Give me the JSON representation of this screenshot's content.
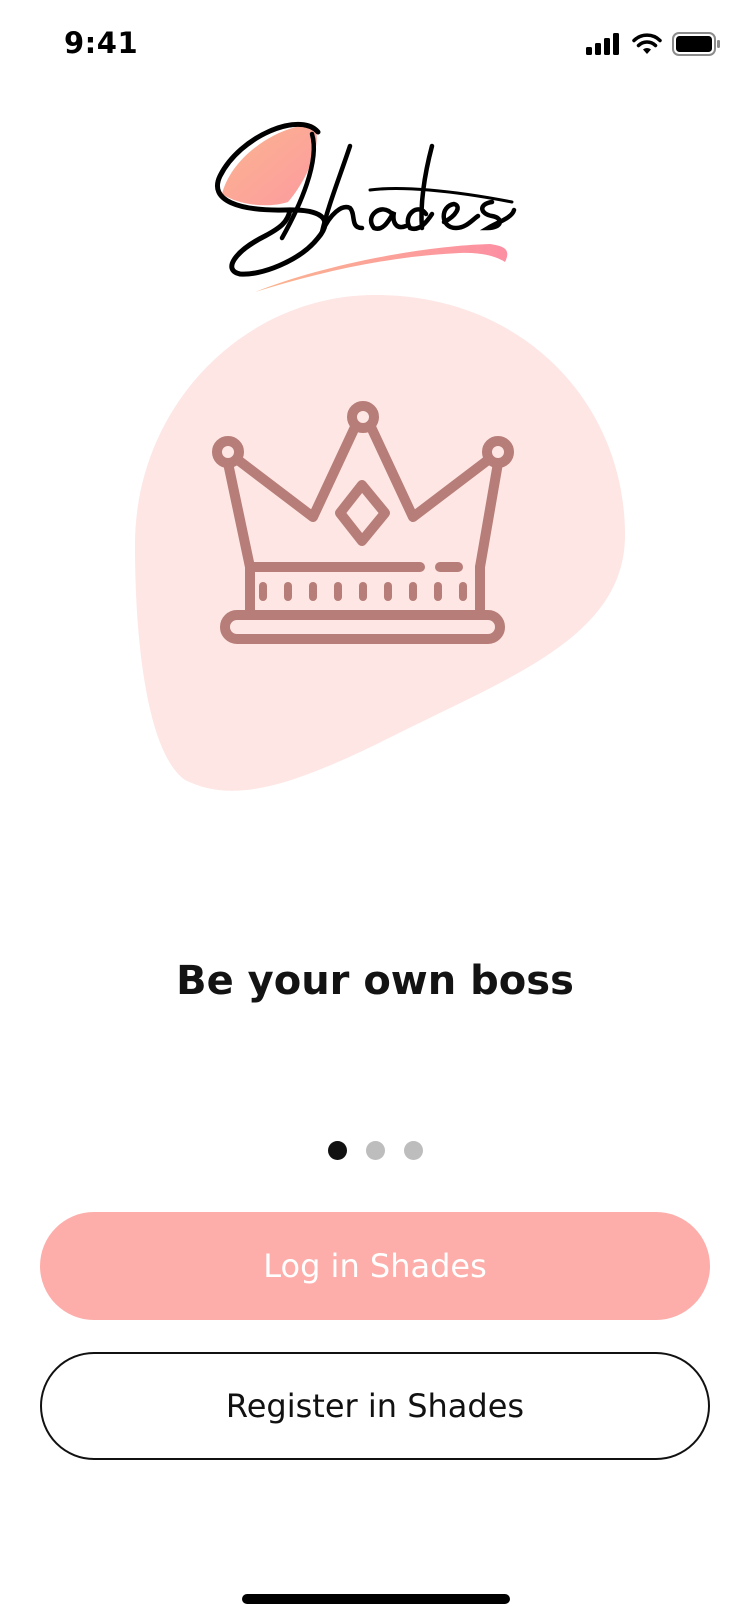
{
  "status_bar": {
    "time": "9:41"
  },
  "app": {
    "brand": "Shades"
  },
  "onboarding": {
    "tagline": "Be your own boss",
    "page_count": 3,
    "active_page": 1
  },
  "buttons": {
    "login_label": "Log in Shades",
    "register_label": "Register in Shades"
  },
  "colors": {
    "primary": "#fdaeaa",
    "blob": "#fde6e4",
    "crown": "#b77d78"
  },
  "icons": [
    "signal-icon",
    "wifi-icon",
    "battery-icon",
    "crown-icon"
  ]
}
